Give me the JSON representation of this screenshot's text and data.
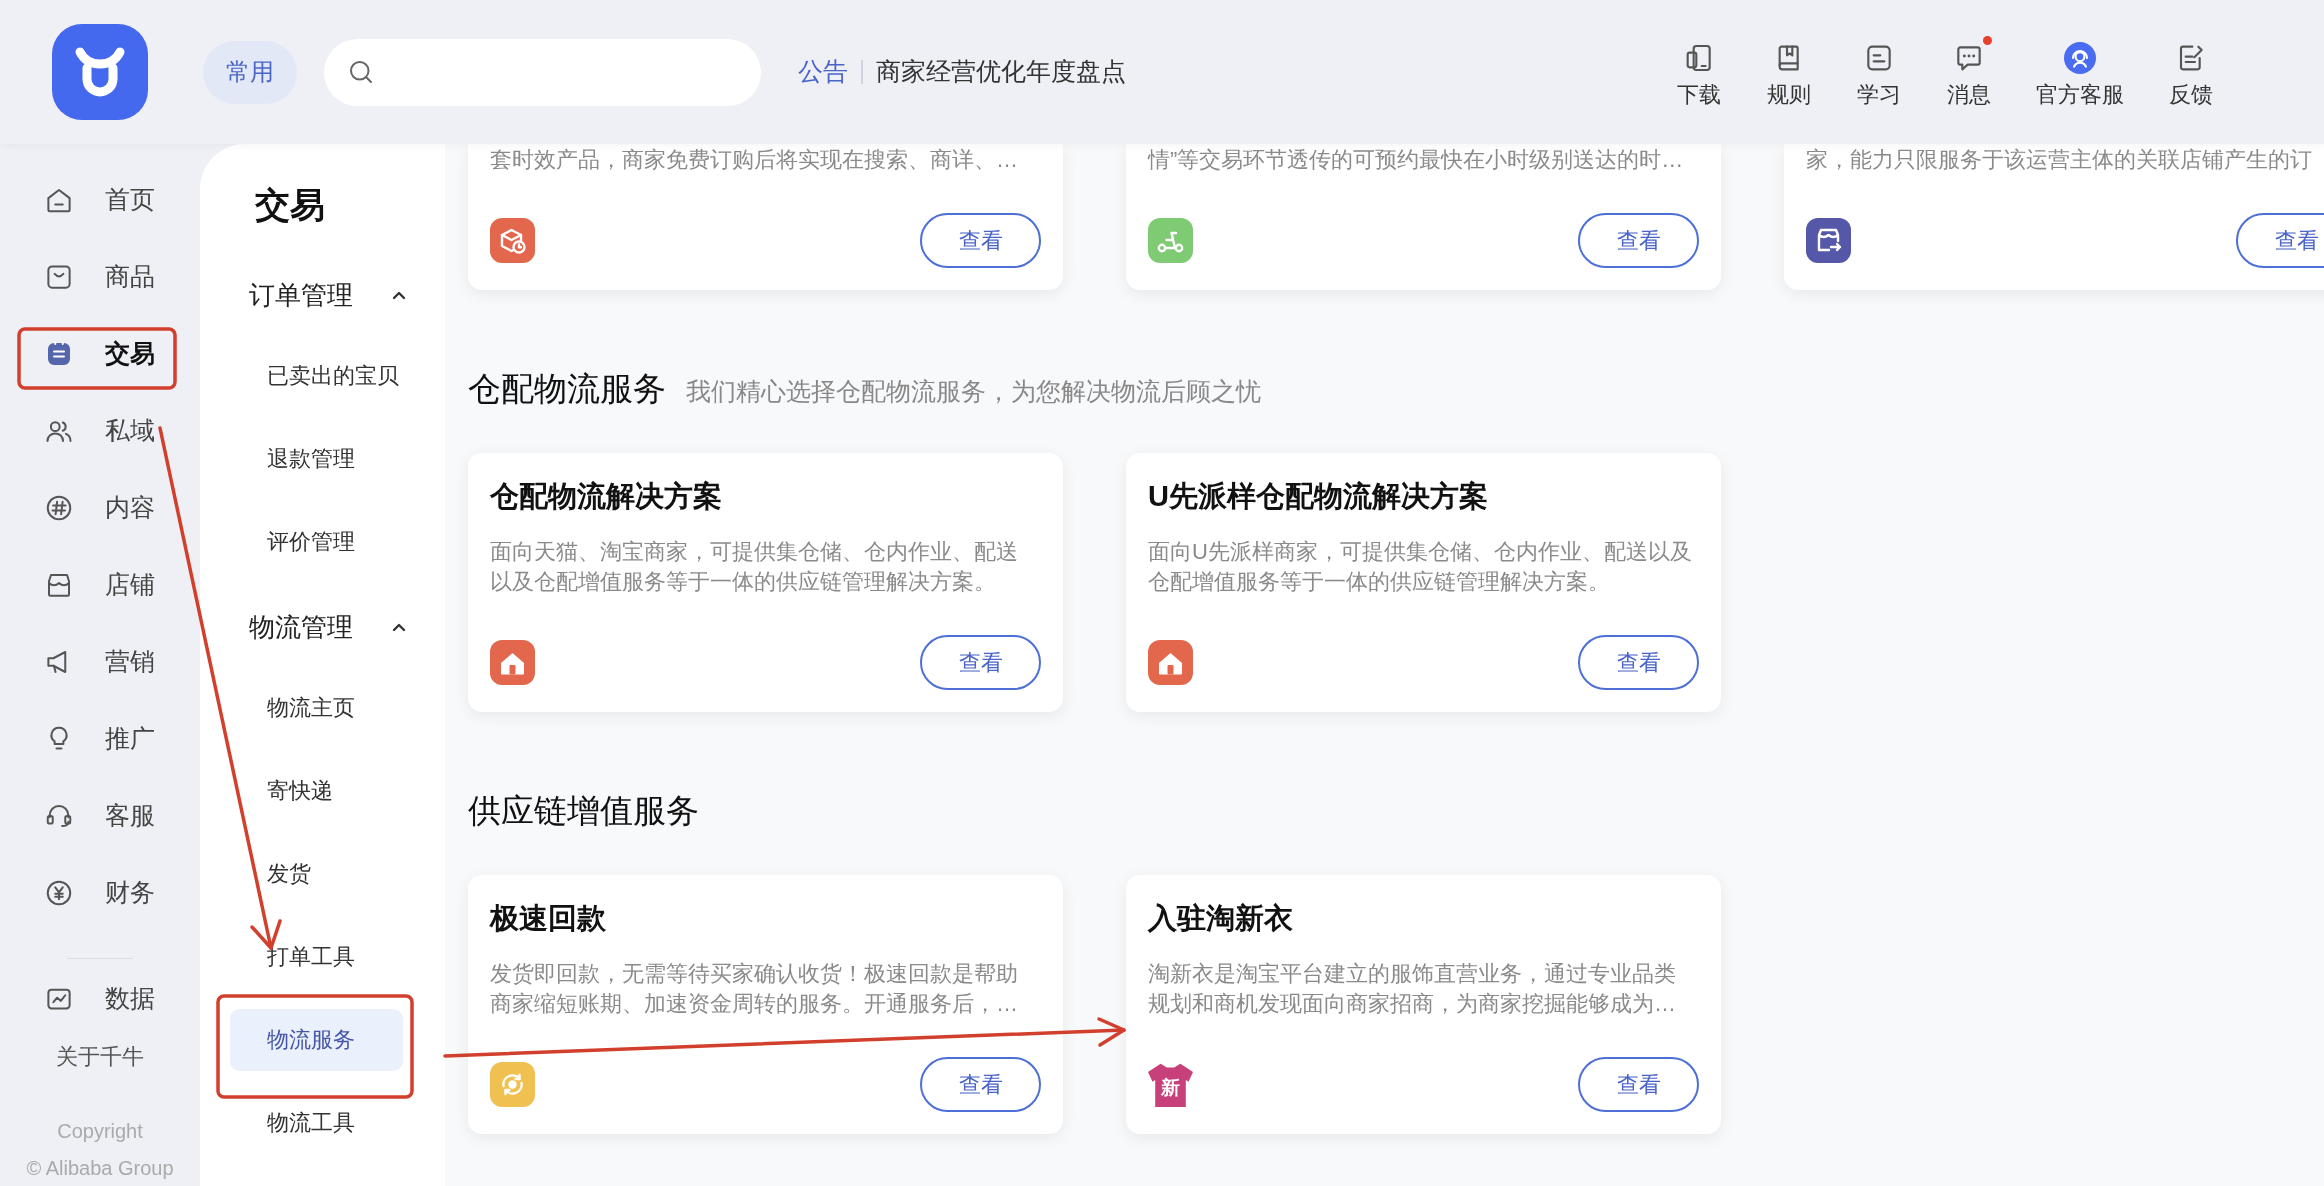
{
  "header": {
    "quick_access": "常用",
    "announcement": {
      "label": "公告",
      "text": "商家经营优化年度盘点"
    },
    "tools": [
      {
        "label": "下载",
        "notification": false
      },
      {
        "label": "规则",
        "notification": false
      },
      {
        "label": "学习",
        "notification": false
      },
      {
        "label": "消息",
        "notification": true
      },
      {
        "label": "官方客服",
        "notification": false
      },
      {
        "label": "反馈",
        "notification": false
      }
    ]
  },
  "sidebar": {
    "groups": [
      {
        "items": [
          {
            "label": "首页",
            "selected": false
          },
          {
            "label": "商品",
            "selected": false
          },
          {
            "label": "交易",
            "selected": true
          },
          {
            "label": "私域",
            "selected": false
          },
          {
            "label": "内容",
            "selected": false
          },
          {
            "label": "店铺",
            "selected": false
          },
          {
            "label": "营销",
            "selected": false
          },
          {
            "label": "推广",
            "selected": false
          },
          {
            "label": "客服",
            "selected": false
          },
          {
            "label": "财务",
            "selected": false
          }
        ]
      },
      {
        "items": [
          {
            "label": "数据",
            "selected": false
          }
        ]
      }
    ],
    "footer": {
      "about": "关于千牛",
      "copyright": "Copyright",
      "company": "© Alibaba Group"
    }
  },
  "submenu": {
    "title": "交易",
    "groups": [
      {
        "label": "订单管理",
        "expanded": true,
        "children": [
          {
            "label": "已卖出的宝贝",
            "selected": false
          },
          {
            "label": "退款管理",
            "selected": false
          },
          {
            "label": "评价管理",
            "selected": false
          }
        ]
      },
      {
        "label": "物流管理",
        "expanded": true,
        "children": [
          {
            "label": "物流主页",
            "selected": false
          },
          {
            "label": "寄快递",
            "selected": false
          },
          {
            "label": "发货",
            "selected": false
          },
          {
            "label": "打单工具",
            "selected": false
          },
          {
            "label": "物流服务",
            "selected": true
          },
          {
            "label": "物流工具",
            "selected": false
          }
        ]
      }
    ]
  },
  "sections": [
    {
      "cards": [
        {
          "description": "套时效产品，商家免费订购后将实现在搜索、商详、…",
          "color": "#e2674c",
          "button": "查看"
        },
        {
          "description": "情”等交易环节透传的可预约最快在小时级别送达的时…",
          "color": "#7fcb73",
          "button": "查看"
        },
        {
          "description": "家，能力只限服务于该运营主体的关联店铺产生的订",
          "color": "#5558a8",
          "button": "查看"
        }
      ]
    },
    {
      "title": "仓配物流服务",
      "subtitle": "我们精心选择仓配物流服务，为您解决物流后顾之忧",
      "cards": [
        {
          "title": "仓配物流解决方案",
          "description": "面向天猫、淘宝商家，可提供集仓储、仓内作业、配送以及仓配增值服务等于一体的供应链管理解决方案。",
          "color": "#e2674c",
          "button": "查看"
        },
        {
          "title": "U先派样仓配物流解决方案",
          "description": "面向U先派样商家，可提供集仓储、仓内作业、配送以及仓配增值服务等于一体的供应链管理解决方案。",
          "color": "#e2674c",
          "button": "查看"
        }
      ]
    },
    {
      "title": "供应链增值服务",
      "cards": [
        {
          "title": "极速回款",
          "description": "发货即回款，无需等待买家确认收货！极速回款是帮助商家缩短账期、加速资金周转的服务。开通服务后，…",
          "color": "#f0c050",
          "button": "查看"
        },
        {
          "title": "入驻淘新衣",
          "description": "淘新衣是淘宝平台建立的服饰直营业务，通过专业品类规划和商机发现面向商家招商，为商家挖掘能够成为…",
          "color": "#c8407a",
          "logo_text": "新",
          "button": "查看"
        }
      ]
    }
  ]
}
